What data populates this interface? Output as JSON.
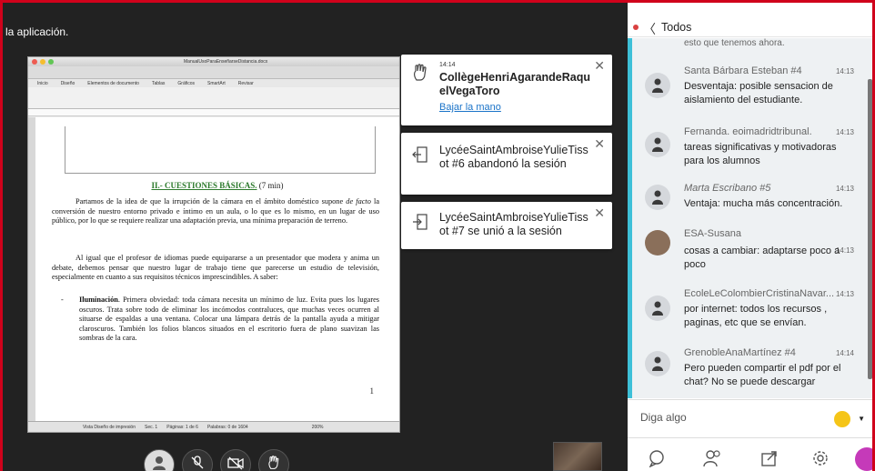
{
  "share": {
    "label": "la aplicación."
  },
  "document": {
    "window_title": "ManualUsoParaEnseñarseDistancia.docx",
    "tabs": [
      "Inicio",
      "Diseño",
      "Elementos de documento",
      "Tablas",
      "Gráficos",
      "SmartArt",
      "Revisar"
    ],
    "heading_main": "II.- CUESTIONES BÁSICAS.",
    "heading_suffix": " (7 min)",
    "para1_a": "Partamos de la idea de que la irrupción de la cámara en el ámbito doméstico supone ",
    "para1_em": "de facto",
    "para1_b": " la conversión de nuestro entorno privado e íntimo en un aula, o lo que es lo mismo, en un lugar de uso público, por lo que se requiere realizar una adaptación previa, una mínima preparación de terreno.",
    "para2": "Al igual que el profesor de idiomas puede equipararse a un presentador que modera y anima un debate, debemos pensar que nuestro lugar de trabajo tiene que parecerse un estudio de televisión, especialmente en cuanto a sus requisitos técnicos imprescindibles. A saber:",
    "bullet_bold": "Iluminación",
    "bullet_text": ". Primera obviedad: toda cámara necesita un mínimo de luz. Evita pues los lugares oscuros. Trata sobre todo de eliminar los incómodos contraluces, que muchas veces ocurren al situarse de espaldas a una ventana. Colocar una lámpara detrás de la pantalla ayuda a mitigar claroscuros. También los folios blancos situados en el escritorio fuera de plano suavizan las sombras de la cara.",
    "page_number": "1",
    "status_items": [
      "Vista Diseño de impresión",
      "Sec. 1",
      "Páginas: 1 de 6",
      "Palabras: 0 de 1604",
      "200%"
    ]
  },
  "notifications": [
    {
      "time": "14:14",
      "text": "CollègeHenriAgarandeRaquelVegaToro",
      "link": "Bajar la mano",
      "icon": "raised-hand-icon"
    },
    {
      "text": "LycéeSaintAmbroiseYulieTissot #6 abandonó la sesión",
      "icon": "leave-session-icon"
    },
    {
      "text": "LycéeSaintAmbroiseYulieTissot #7 se unió a la sesión",
      "icon": "join-session-icon"
    }
  ],
  "chat": {
    "title": "Todos",
    "cut_text": "esto que tenemos ahora.",
    "messages": [
      {
        "author": "Santa Bárbara Esteban #4",
        "time": "14:13",
        "text": "Desventaja: posible sensacion de aislamiento del estudiante.",
        "italic": false
      },
      {
        "author": "Fernanda. eoimadridtribunal.",
        "time": "14:13",
        "text": "tareas significativas y motivadoras para los alumnos",
        "italic": false
      },
      {
        "author": "Marta Escribano #5",
        "time": "14:13",
        "text": "Ventaja: mucha más concentración.",
        "italic": true
      },
      {
        "author": "ESA-Susana",
        "time": "14:13",
        "text": "cosas a cambiar: adaptarse poco a poco",
        "italic": false
      },
      {
        "author": "EcoleLeColombierCristinaNavar...",
        "time": "14:13",
        "text": "por internet: todos los recursos , paginas, etc que se envían.",
        "italic": false
      },
      {
        "author": "GrenobleAnaMartínez #4",
        "time": "14:14",
        "text": "Pero pueden compartir el pdf por el chat? No se puede descargar",
        "italic": false
      }
    ],
    "input_placeholder": "Diga algo"
  },
  "colors": {
    "accent_red": "#d0021b",
    "chat_accent": "#3ec0d8",
    "link": "#1a73c8",
    "leave_close": "#c53ab9"
  }
}
